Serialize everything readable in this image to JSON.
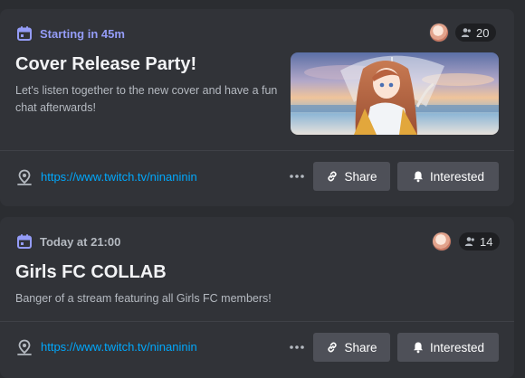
{
  "colors": {
    "background": "#2b2d31",
    "card": "#313338",
    "accent_purple": "#949cf7",
    "link": "#00a8fc",
    "button": "#4e5058"
  },
  "events": [
    {
      "when": "Starting in 45m",
      "when_color": "#949cf7",
      "title": "Cover Release Party!",
      "description": "Let's listen together to the new cover and have a fun chat afterwards!",
      "interested_count": "20",
      "has_banner": true,
      "location": "https://www.twitch.tv/ninaninin",
      "share_label": "Share",
      "interested_label": "Interested",
      "icons": {
        "calendar": "calendar-icon",
        "location": "location-pin-icon",
        "more": "more-dots-icon",
        "share": "link-icon",
        "interested": "bell-icon",
        "people": "people-icon"
      }
    },
    {
      "when": "Today at 21:00",
      "when_color": "#b5bac1",
      "title": "Girls FC COLLAB",
      "description": "Banger of a stream featuring all Girls FC members!",
      "interested_count": "14",
      "has_banner": false,
      "location": "https://www.twitch.tv/ninaninin",
      "share_label": "Share",
      "interested_label": "Interested",
      "icons": {
        "calendar": "calendar-icon",
        "location": "location-pin-icon",
        "more": "more-dots-icon",
        "share": "link-icon",
        "interested": "bell-icon",
        "people": "people-icon"
      }
    }
  ]
}
